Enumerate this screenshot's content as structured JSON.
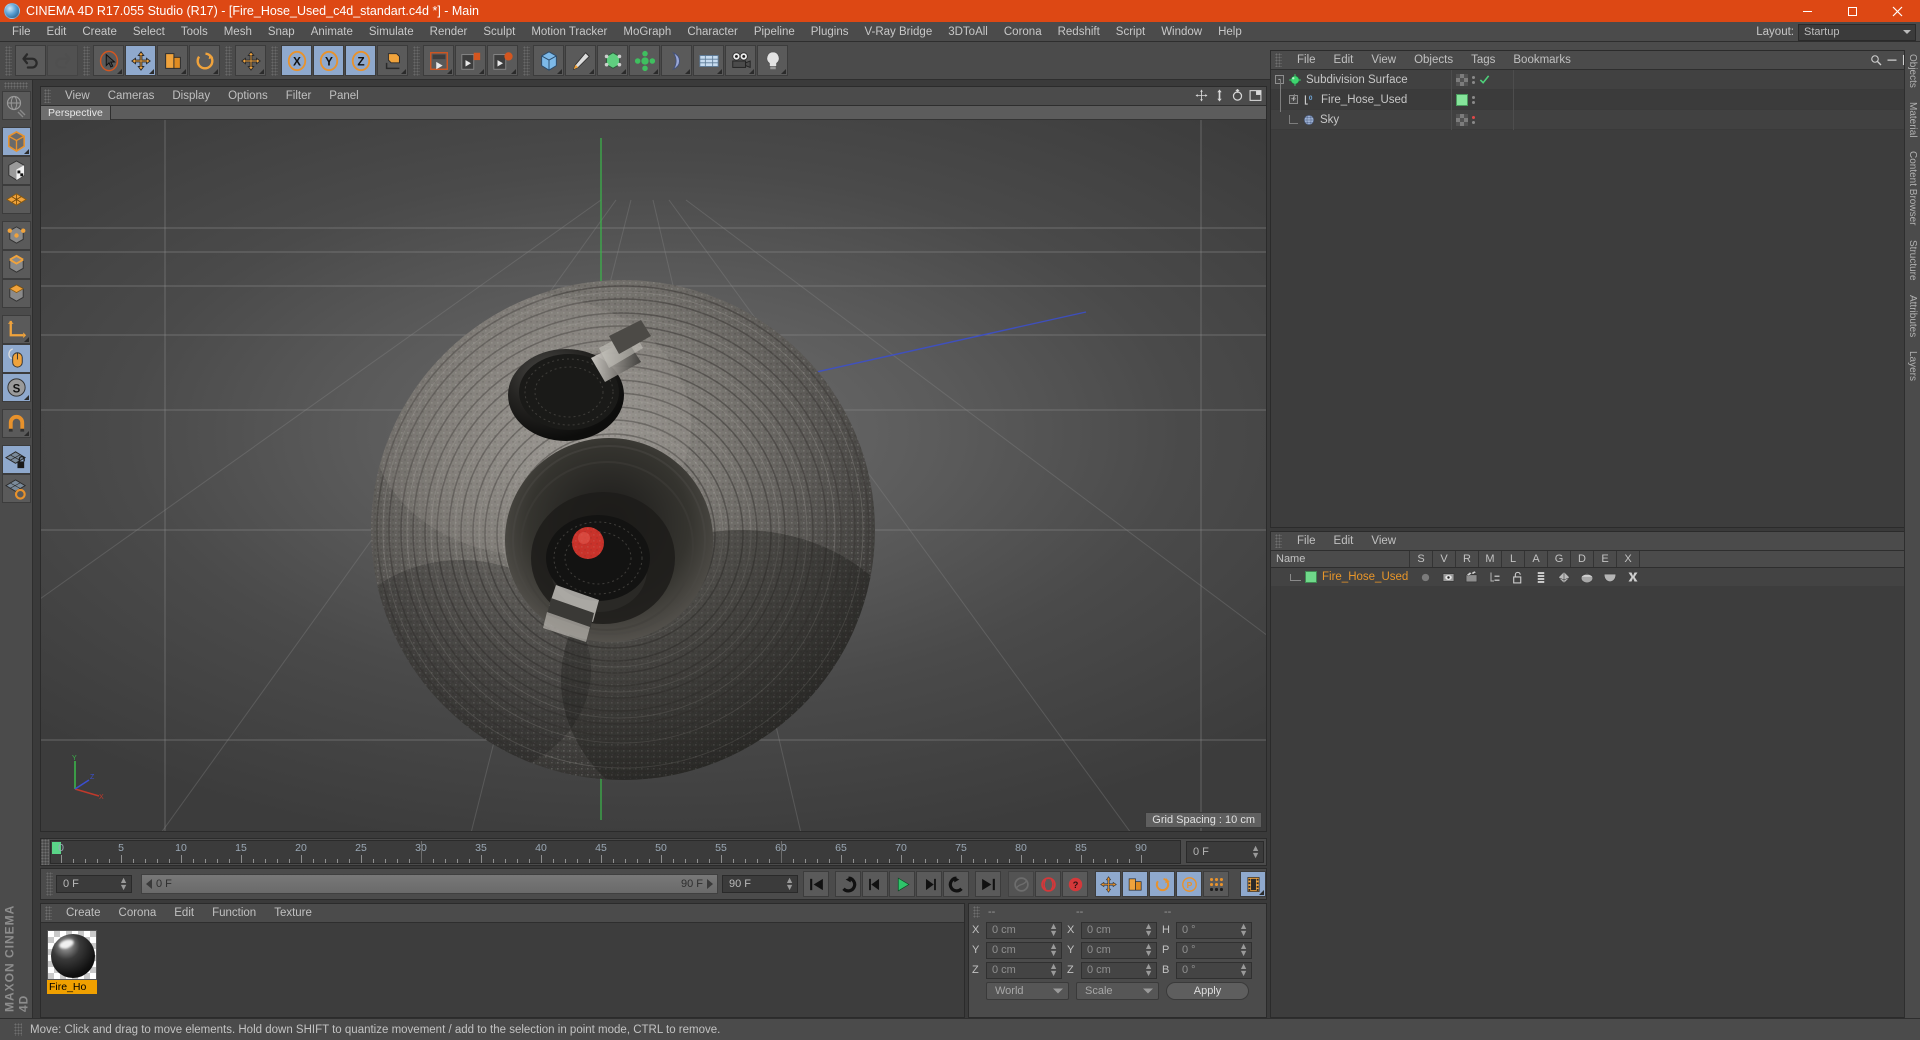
{
  "window": {
    "title": "CINEMA 4D R17.055 Studio (R17) - [Fire_Hose_Used_c4d_standart.c4d *] - Main",
    "app_icon": "cinema4d-logo-icon",
    "minimize_label": "Minimize",
    "maximize_label": "Restore",
    "close_label": "Close"
  },
  "menubar": {
    "items": [
      {
        "label": "File"
      },
      {
        "label": "Edit"
      },
      {
        "label": "Create"
      },
      {
        "label": "Select"
      },
      {
        "label": "Tools"
      },
      {
        "label": "Mesh"
      },
      {
        "label": "Snap"
      },
      {
        "label": "Animate"
      },
      {
        "label": "Simulate"
      },
      {
        "label": "Render"
      },
      {
        "label": "Sculpt"
      },
      {
        "label": "Motion Tracker"
      },
      {
        "label": "MoGraph"
      },
      {
        "label": "Character"
      },
      {
        "label": "Pipeline"
      },
      {
        "label": "Plugins"
      },
      {
        "label": "V-Ray Bridge"
      },
      {
        "label": "3DToAll"
      },
      {
        "label": "Corona"
      },
      {
        "label": "Redshift"
      },
      {
        "label": "Script"
      },
      {
        "label": "Window"
      },
      {
        "label": "Help"
      }
    ],
    "layout_label": "Layout:",
    "layout_value": "Startup"
  },
  "toolbar": {
    "groups": [
      {
        "buttons": [
          {
            "name": "undo-button",
            "icon": "undo-arrow-icon",
            "active": false
          },
          {
            "name": "redo-button",
            "icon": "redo-arrow-icon",
            "active": false,
            "disabled": true
          }
        ]
      },
      {
        "buttons": [
          {
            "name": "live-selection-tool",
            "icon": "cursor-arrow-icon",
            "active": false
          },
          {
            "name": "move-tool",
            "icon": "move-axis-icon",
            "active": true
          },
          {
            "name": "scale-tool",
            "icon": "scale-box-icon",
            "active": false
          },
          {
            "name": "rotate-tool",
            "icon": "rotate-circle-icon",
            "active": false
          }
        ]
      },
      {
        "buttons": [
          {
            "name": "move-duplicate-tool",
            "icon": "move-cross-icon",
            "active": false
          }
        ]
      },
      {
        "buttons": [
          {
            "name": "lock-x-axis-button",
            "icon": "x-axis-icon",
            "label": "X",
            "active": true
          },
          {
            "name": "lock-y-axis-button",
            "icon": "y-axis-icon",
            "label": "Y",
            "active": true
          },
          {
            "name": "lock-z-axis-button",
            "icon": "z-axis-icon",
            "label": "Z",
            "active": true
          },
          {
            "name": "world-object-coordinates-button",
            "icon": "world-coordinate-icon",
            "active": false
          }
        ]
      },
      {
        "buttons": [
          {
            "name": "render-view-button",
            "icon": "render-clapper-icon",
            "active": false
          },
          {
            "name": "render-to-picture-viewer-button",
            "icon": "render-picture-viewer-icon",
            "active": false
          },
          {
            "name": "edit-render-settings-button",
            "icon": "render-settings-icon",
            "active": false
          }
        ]
      },
      {
        "buttons": [
          {
            "name": "add-cube-button",
            "icon": "cube-primitive-icon",
            "active": false
          },
          {
            "name": "add-spline-button",
            "icon": "pen-spline-icon",
            "active": false
          },
          {
            "name": "add-generator-button",
            "icon": "generator-nurbs-icon",
            "active": false
          },
          {
            "name": "add-mograph-button",
            "icon": "mograph-cloner-icon",
            "active": false
          },
          {
            "name": "add-deformer-button",
            "icon": "deformer-bend-icon",
            "active": false
          },
          {
            "name": "add-environment-button",
            "icon": "environment-floor-icon",
            "active": false
          },
          {
            "name": "add-camera-button",
            "icon": "camera-icon",
            "active": false
          },
          {
            "name": "add-light-button",
            "icon": "light-bulb-icon",
            "active": false
          }
        ]
      }
    ]
  },
  "left_toolbar": {
    "buttons": [
      {
        "name": "make-editable-button",
        "icon": "make-editable-globe-icon",
        "active": false
      },
      {
        "name": "model-mode-button",
        "icon": "model-cube-icon",
        "active": true,
        "group_end": false
      },
      {
        "name": "texture-mode-button",
        "icon": "texture-checker-cube-icon",
        "active": false
      },
      {
        "name": "workplane-mode-button",
        "icon": "workplane-grid-icon",
        "active": false,
        "group_end": true
      },
      {
        "name": "point-mode-button",
        "icon": "points-cube-icon",
        "active": false
      },
      {
        "name": "edge-mode-button",
        "icon": "edges-cube-icon",
        "active": false
      },
      {
        "name": "polygon-mode-button",
        "icon": "polygon-cube-icon",
        "active": false,
        "group_end": true
      },
      {
        "name": "object-axis-mode-button",
        "icon": "axis-l-icon",
        "active": false
      },
      {
        "name": "viewport-solo-button",
        "icon": "mouse-icon",
        "active": true
      },
      {
        "name": "snap-settings-button",
        "icon": "snap-s-icon",
        "active": true,
        "group_end": true
      },
      {
        "name": "enable-snapping-button",
        "icon": "magnet-icon",
        "active": false,
        "group_end": true
      },
      {
        "name": "lock-workplane-button",
        "icon": "workplane-lock-icon",
        "active": true
      },
      {
        "name": "workplane-to-selection-button",
        "icon": "workplane-orange-icon",
        "active": false
      }
    ],
    "brand": "MAXON CINEMA 4D"
  },
  "viewport": {
    "menu": [
      {
        "label": "View"
      },
      {
        "label": "Cameras"
      },
      {
        "label": "Display"
      },
      {
        "label": "Options"
      },
      {
        "label": "Filter"
      },
      {
        "label": "Panel"
      }
    ],
    "tab_label": "Perspective",
    "grid_spacing": "Grid Spacing : 10 cm",
    "axis_labels": {
      "x": "X",
      "y": "Y",
      "z": "Z"
    },
    "corner_icons": [
      {
        "name": "viewport-move-icon"
      },
      {
        "name": "viewport-scale-icon"
      },
      {
        "name": "viewport-rotate-icon"
      },
      {
        "name": "viewport-maximize-icon"
      }
    ]
  },
  "timeline": {
    "ticks": [
      {
        "value": "0",
        "pos": 0
      },
      {
        "value": "5",
        "pos": 5
      },
      {
        "value": "10",
        "pos": 10
      },
      {
        "value": "15",
        "pos": 15
      },
      {
        "value": "20",
        "pos": 20
      },
      {
        "value": "25",
        "pos": 25
      },
      {
        "value": "30",
        "pos": 30
      },
      {
        "value": "35",
        "pos": 35
      },
      {
        "value": "40",
        "pos": 40
      },
      {
        "value": "45",
        "pos": 45
      },
      {
        "value": "50",
        "pos": 50
      },
      {
        "value": "55",
        "pos": 55
      },
      {
        "value": "60",
        "pos": 60
      },
      {
        "value": "65",
        "pos": 65
      },
      {
        "value": "70",
        "pos": 70
      },
      {
        "value": "75",
        "pos": 75
      },
      {
        "value": "80",
        "pos": 80
      },
      {
        "value": "85",
        "pos": 85
      },
      {
        "value": "90",
        "pos": 90
      }
    ],
    "range_min": 0,
    "range_max": 90,
    "current_frame_field": "0 F"
  },
  "transport": {
    "current_frame": "0 F",
    "range_start": "0 F",
    "range_end": "90 F",
    "preview_end": "90 F",
    "buttons": [
      {
        "name": "go-to-start-button",
        "icon": "skip-to-start-icon",
        "active": false
      },
      {
        "name": "go-to-previous-keyframe-button",
        "icon": "previous-keyframe-icon",
        "active": false
      },
      {
        "name": "step-back-button",
        "icon": "step-back-icon",
        "active": false
      },
      {
        "name": "play-button",
        "icon": "play-icon",
        "active": false
      },
      {
        "name": "step-forward-button",
        "icon": "step-forward-icon",
        "active": false
      },
      {
        "name": "go-to-next-keyframe-button",
        "icon": "next-keyframe-icon",
        "active": false
      },
      {
        "name": "go-to-end-button",
        "icon": "skip-to-end-icon",
        "active": false
      },
      {
        "name": "record-active-objects-button",
        "icon": "record-icon",
        "active": false,
        "disabled": true
      },
      {
        "name": "autokeying-button",
        "icon": "autokey-icon",
        "active": false
      },
      {
        "name": "keyframe-selection-button",
        "icon": "keyframe-select-icon",
        "active": false
      },
      {
        "name": "position-key-button",
        "icon": "position-key-icon",
        "active": true
      },
      {
        "name": "scale-key-button",
        "icon": "scale-key-icon",
        "active": true
      },
      {
        "name": "rotation-key-button",
        "icon": "rotation-key-icon",
        "active": true
      },
      {
        "name": "parameter-key-button",
        "icon": "parameter-key-icon",
        "active": true
      },
      {
        "name": "point-level-animation-button",
        "icon": "pla-dots-icon",
        "active": false
      },
      {
        "name": "timeline-toggle-button",
        "icon": "timeline-filmstrip-icon",
        "active": true
      }
    ]
  },
  "material_manager": {
    "menu": [
      {
        "label": "Create"
      },
      {
        "label": "Corona"
      },
      {
        "label": "Edit"
      },
      {
        "label": "Function"
      },
      {
        "label": "Texture"
      }
    ],
    "materials": [
      {
        "name": "Fire_Ho",
        "full_name": "Fire_Hose_Used",
        "selected": true
      }
    ]
  },
  "coordinate_manager": {
    "headers": [
      "--",
      "--",
      "--"
    ],
    "rows": [
      {
        "label1": "X",
        "value1": "0 cm",
        "label2": "X",
        "value2": "0 cm",
        "label3": "H",
        "value3": "0 °"
      },
      {
        "label1": "Y",
        "value1": "0 cm",
        "label2": "Y",
        "value2": "0 cm",
        "label3": "P",
        "value3": "0 °"
      },
      {
        "label1": "Z",
        "value1": "0 cm",
        "label2": "Z",
        "value2": "0 cm",
        "label3": "B",
        "value3": "0 °"
      }
    ],
    "coord_system": "World",
    "size_mode": "Scale",
    "apply_label": "Apply"
  },
  "object_manager": {
    "menu": [
      {
        "label": "File"
      },
      {
        "label": "Edit"
      },
      {
        "label": "View"
      },
      {
        "label": "Objects"
      },
      {
        "label": "Tags"
      },
      {
        "label": "Bookmarks"
      }
    ],
    "rows": [
      {
        "name": "Subdivision Surface",
        "icon": "subdivision-surface-icon",
        "depth": 0,
        "expander": "-",
        "tags": [
          "checker-tag",
          "dots-tag",
          "check-tag"
        ]
      },
      {
        "name": "Fire_Hose_Used",
        "icon": "null-object-icon",
        "depth": 1,
        "expander": "+",
        "tags": [
          "green-tag",
          "dots-tag"
        ]
      },
      {
        "name": "Sky",
        "icon": "sky-object-icon",
        "depth": 1,
        "expander": "",
        "tags": [
          "checker-tag",
          "red-dot-tag"
        ]
      }
    ]
  },
  "attribute_manager": {
    "menu": [
      {
        "label": "File"
      },
      {
        "label": "Edit"
      },
      {
        "label": "View"
      }
    ],
    "columns": [
      "Name",
      "S",
      "V",
      "R",
      "M",
      "L",
      "A",
      "G",
      "D",
      "E",
      "X"
    ],
    "rows": [
      {
        "name": "Fire_Hose_Used",
        "color_swatch": "#6fd98a",
        "icons": [
          "solo-dot-icon",
          "visible-eye-icon",
          "render-film-icon",
          "manager-tree-icon",
          "lock-open-icon",
          "animation-bars-icon",
          "generator-icon",
          "deformer-icon",
          "expression-icon",
          "xref-icon"
        ]
      }
    ]
  },
  "right_dock": {
    "items": [
      {
        "label": "Objects"
      },
      {
        "label": "Material"
      },
      {
        "label": "Content Browser"
      },
      {
        "label": "Structure"
      },
      {
        "label": "Attributes"
      },
      {
        "label": "Layers"
      }
    ]
  },
  "statusbar": {
    "message": "Move: Click and drag to move elements. Hold down SHIFT to quantize movement / add to the selection in point mode, CTRL to remove."
  },
  "colors": {
    "title_bar": "#dd4814",
    "panel_bg": "#4b4b4b",
    "viewport_bg": "#5b5b5b",
    "active_blue": "#8fa9cd",
    "accent_orange": "#e8962a",
    "green_tag": "#86e59b",
    "x_axis_red": "#c0392b",
    "y_axis_green": "#27ae60",
    "z_axis_blue": "#2b44c0"
  }
}
